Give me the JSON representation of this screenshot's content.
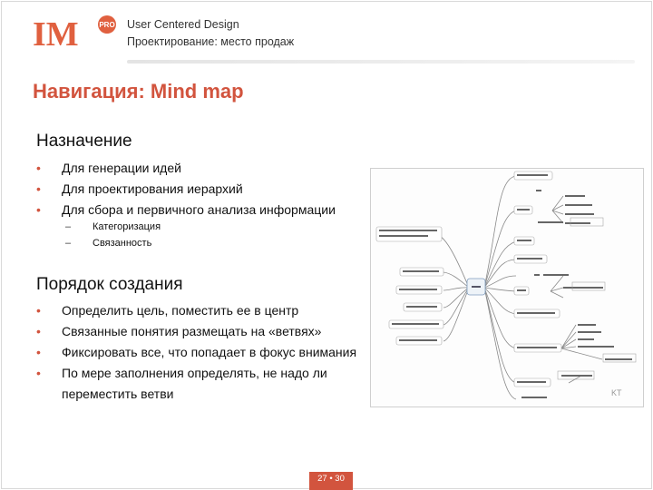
{
  "header": {
    "logo_text": "IM",
    "logo_badge": "PRO",
    "line1": "User Centered Design",
    "line2": "Проектирование: место продаж"
  },
  "title": "Навигация: Mind map",
  "section1": {
    "title": "Назначение",
    "bullets": [
      "Для генерации идей",
      "Для проектирования иерархий",
      "Для сбора и первичного анализа информации"
    ],
    "sub": [
      "Категоризация",
      "Связанность"
    ]
  },
  "section2": {
    "title": "Порядок создания",
    "bullets": [
      "Определить цель, поместить ее в центр",
      "Связанные понятия размещать на «ветвях»",
      "Фиксировать все, что попадает в фокус внимания",
      "По мере заполнения определять, не надо ли переместить ветви"
    ]
  },
  "bullet_glyph": "•",
  "dash_glyph": "–",
  "footer": {
    "page": "27 • 30"
  },
  "colors": {
    "accent": "#d2543e",
    "line": "#888888"
  }
}
